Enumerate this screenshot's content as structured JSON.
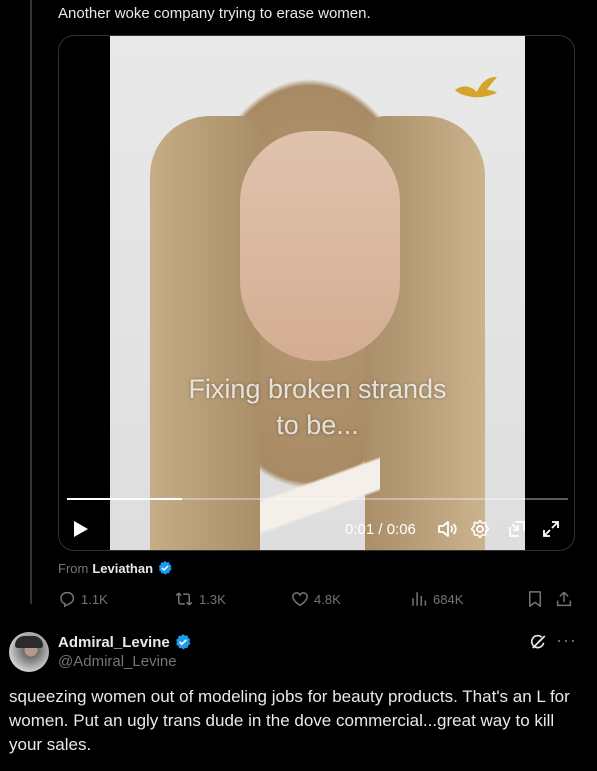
{
  "tweet": {
    "text": "Another woke company trying to erase women."
  },
  "video": {
    "caption_line1": "Fixing broken strands",
    "caption_line2": "to be...",
    "time": "0:01 / 0:06",
    "progress": 0.23
  },
  "source": {
    "label": "From",
    "name": "Leviathan"
  },
  "actions": {
    "replies": "1.1K",
    "reposts": "1.3K",
    "likes": "4.8K",
    "views": "684K"
  },
  "reply": {
    "display_name": "Admiral_Levine",
    "handle": "@Admiral_Levine",
    "text": "squeezing women out of modeling jobs for beauty products. That's an L for women. Put an ugly trans dude in the dove commercial...great way to kill your sales.",
    "more_label": "···"
  },
  "colors": {
    "background": "#000000",
    "text": "#e7e9ea",
    "muted": "#71767b",
    "verified": "#1d9bf0",
    "dove_gold": "#d4a52a"
  },
  "icons": [
    "reply-icon",
    "retweet-icon",
    "like-icon",
    "views-icon",
    "bookmark-icon",
    "share-icon",
    "verified-icon",
    "grok-icon",
    "play-icon",
    "volume-icon",
    "settings-icon",
    "pip-icon",
    "fullscreen-icon"
  ]
}
